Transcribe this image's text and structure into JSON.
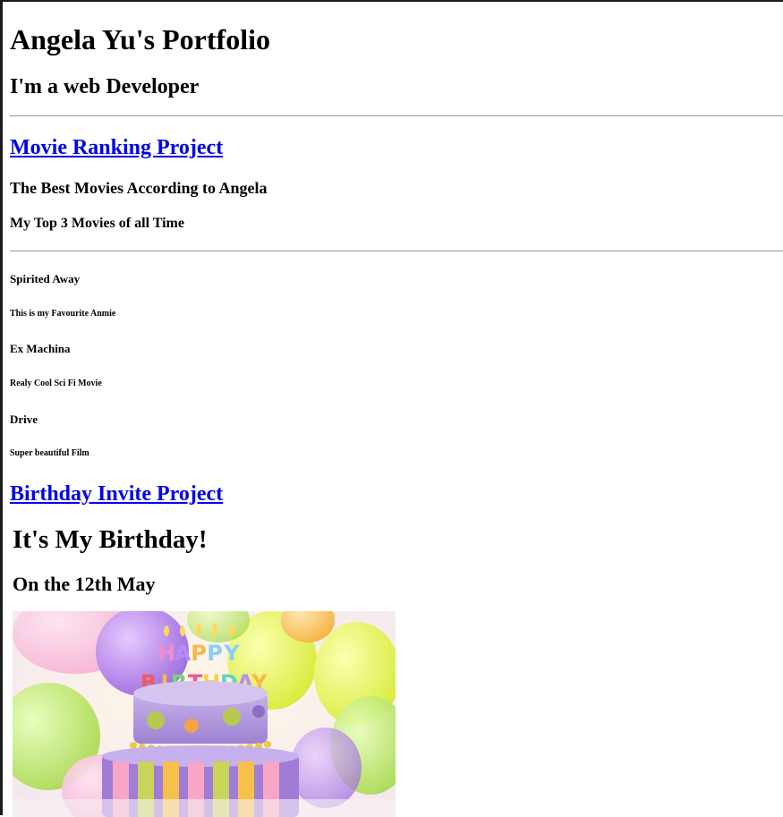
{
  "header": {
    "title": "Angela Yu's Portfolio",
    "subtitle": "I'm a web Developer"
  },
  "movie_section": {
    "link_label": "Movie Ranking Project",
    "heading": "The Best Movies According to Angela",
    "subheading": "My Top 3 Movies of all Time",
    "movies": [
      {
        "title": "Spirited Away",
        "description": "This is my Favourite Anmie"
      },
      {
        "title": "Ex Machina",
        "description": "Realy Cool Sci Fi Movie"
      },
      {
        "title": "Drive",
        "description": "Super beautiful Film"
      }
    ]
  },
  "birthday_section": {
    "link_label": "Birthday Invite Project",
    "heading": "It's My Birthday!",
    "date": "On the 12th May",
    "cake_letters": "HAPPY BIRTHDAY"
  },
  "colors": {
    "link": "#0000ee",
    "rule": "#9a9a9a"
  },
  "icons": {
    "cake_image": "birthday-cake-image"
  }
}
